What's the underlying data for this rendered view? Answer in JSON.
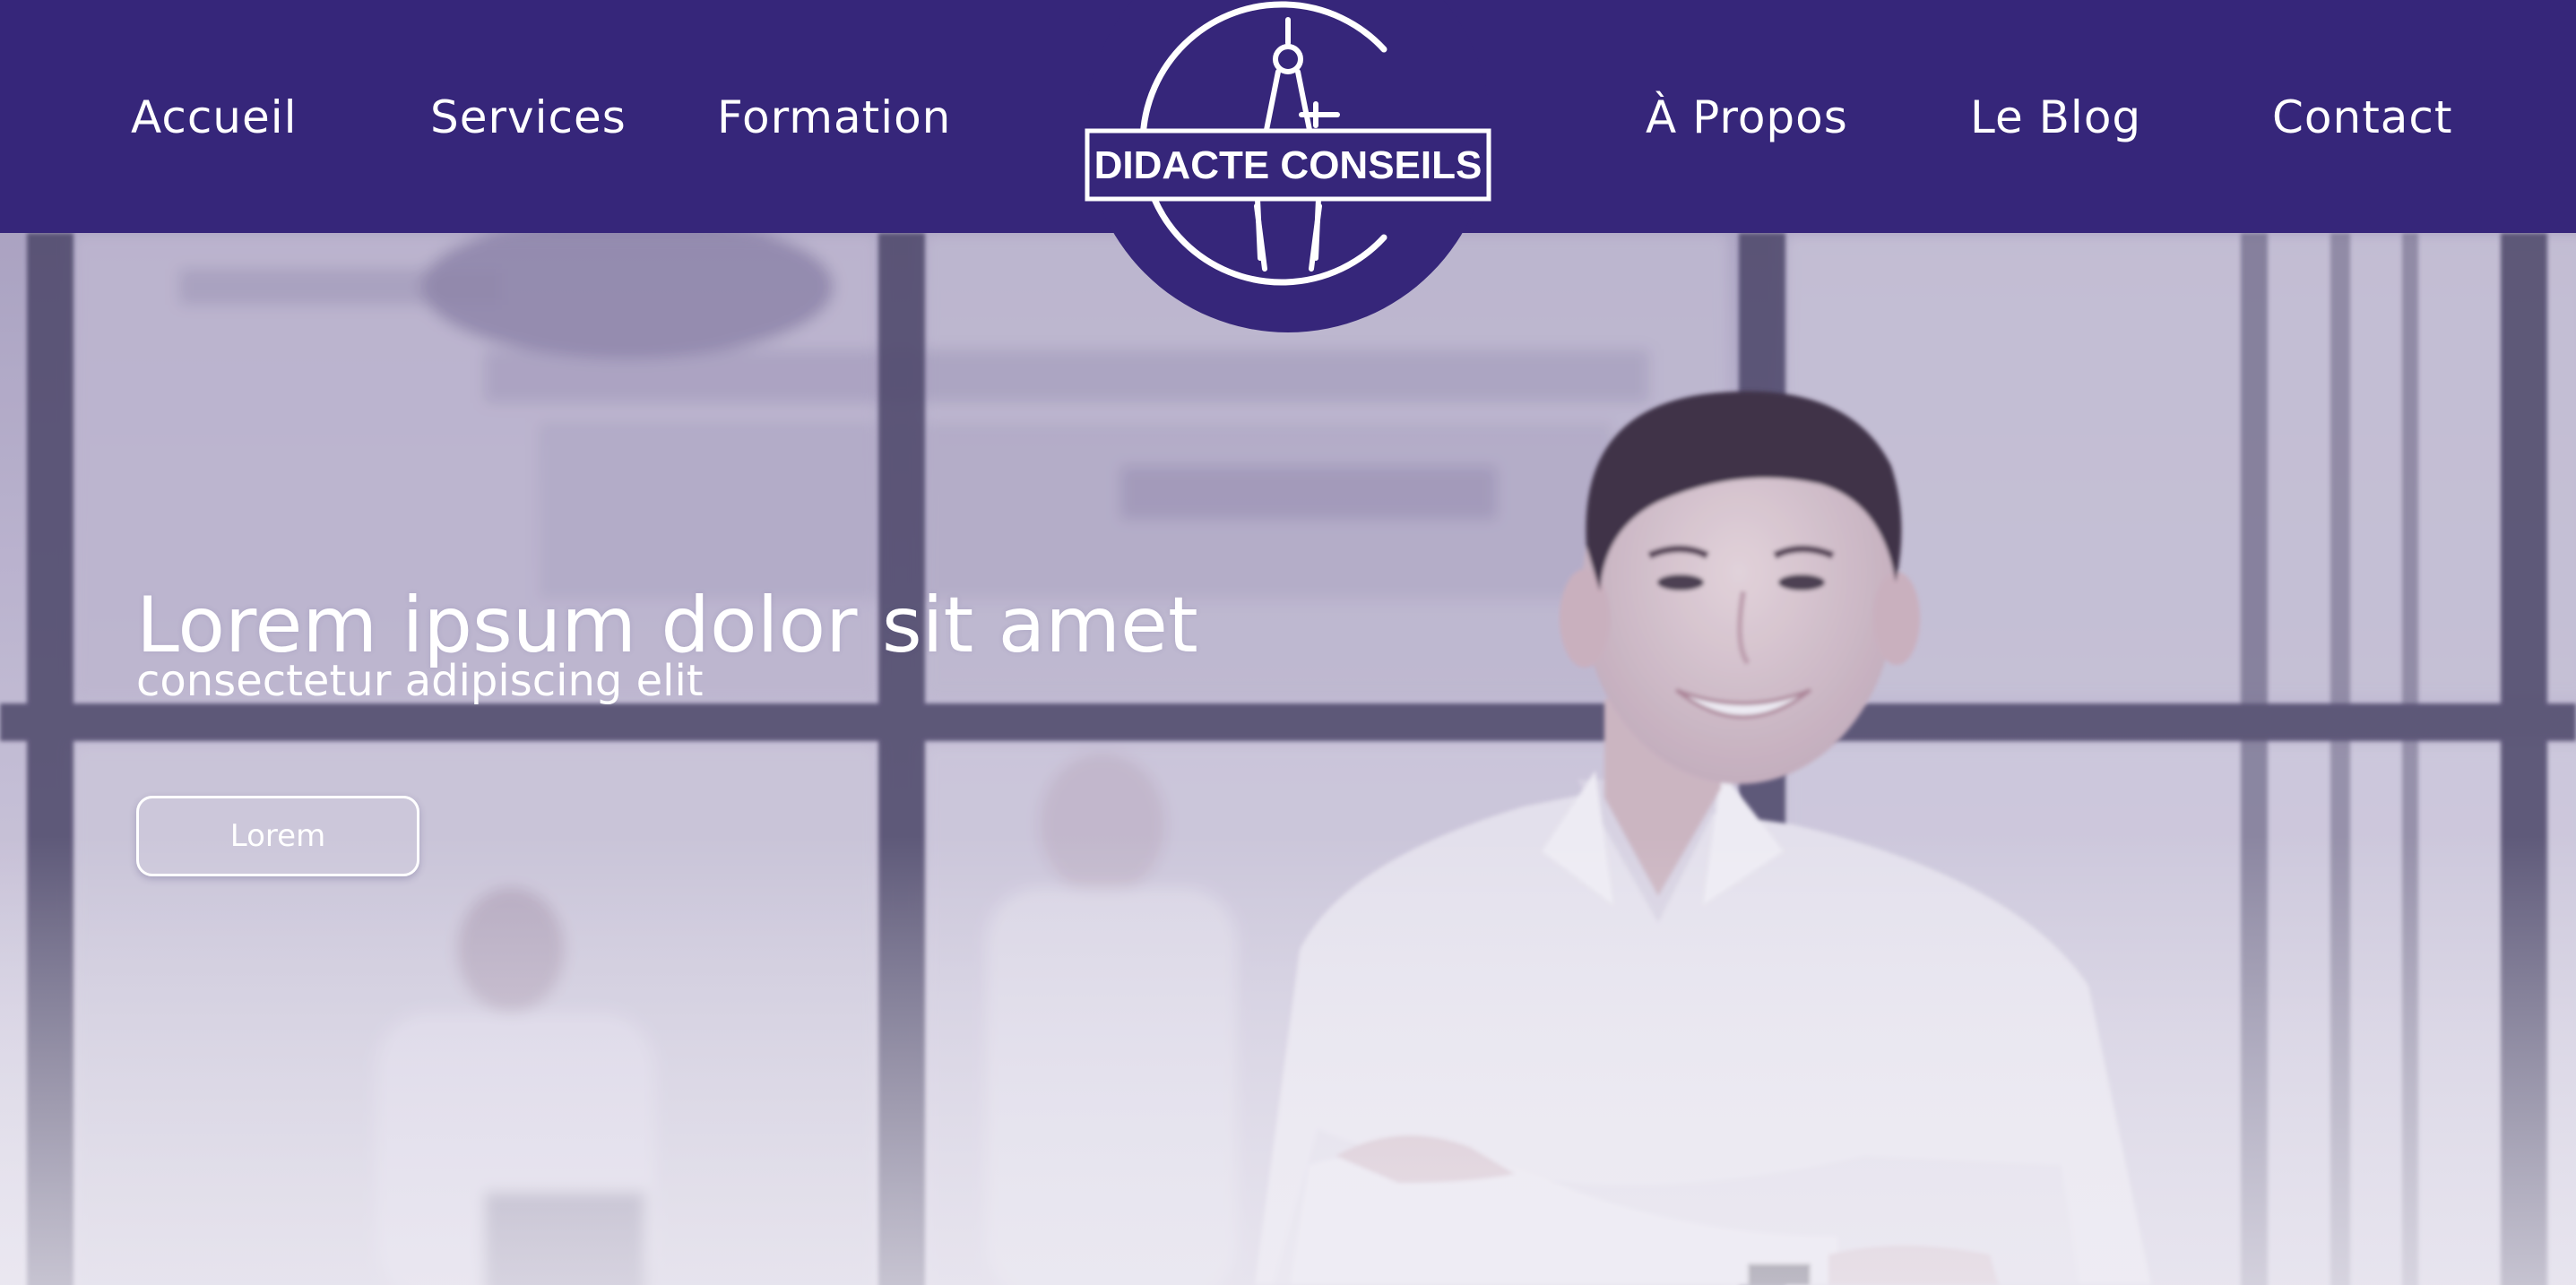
{
  "header": {
    "background_color": "#36267a",
    "nav_left": [
      {
        "label": "Accueil"
      },
      {
        "label": "Services"
      },
      {
        "label": "Formation"
      }
    ],
    "nav_right": [
      {
        "label": "À Propos"
      },
      {
        "label": "Le Blog"
      },
      {
        "label": "Contact"
      }
    ],
    "logo": {
      "text": "DIDACTE CONSEILS",
      "icon": "drafting-compass-icon"
    }
  },
  "hero": {
    "title": "Lorem ipsum dolor sit amet",
    "subtitle": "consectetur adipiscing elit",
    "cta_label": "Lorem",
    "image": "smiling-man-in-white-shirt-office-photo"
  },
  "colors": {
    "brand_purple": "#36267a",
    "text_white": "#ffffff"
  }
}
